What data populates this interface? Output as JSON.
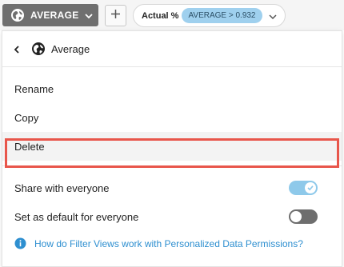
{
  "toolbar": {
    "view_button_label": "AVERAGE",
    "add_button_label": "+",
    "filter": {
      "name": "Actual %",
      "condition": "AVERAGE > 0.932"
    }
  },
  "menu": {
    "header_title": "Average",
    "items": [
      {
        "label": "Rename"
      },
      {
        "label": "Copy"
      },
      {
        "label": "Delete"
      }
    ],
    "toggles": [
      {
        "label": "Share with everyone",
        "state": "on"
      },
      {
        "label": "Set as default for everyone",
        "state": "off"
      }
    ],
    "help_link": "How do Filter Views work with Personalized Data Permissions?"
  },
  "colors": {
    "view_button_bg": "#6f6f6f",
    "filter_badge_bg": "#9fd0ee",
    "toggle_on": "#8ec9ea",
    "toggle_off": "#6e6e6e",
    "highlight_border": "#e8564b",
    "link": "#2e8fd0"
  },
  "icons": [
    "globe-icon",
    "chevron-down-icon",
    "plus-icon",
    "back-chevron-icon",
    "check-icon",
    "info-icon"
  ]
}
